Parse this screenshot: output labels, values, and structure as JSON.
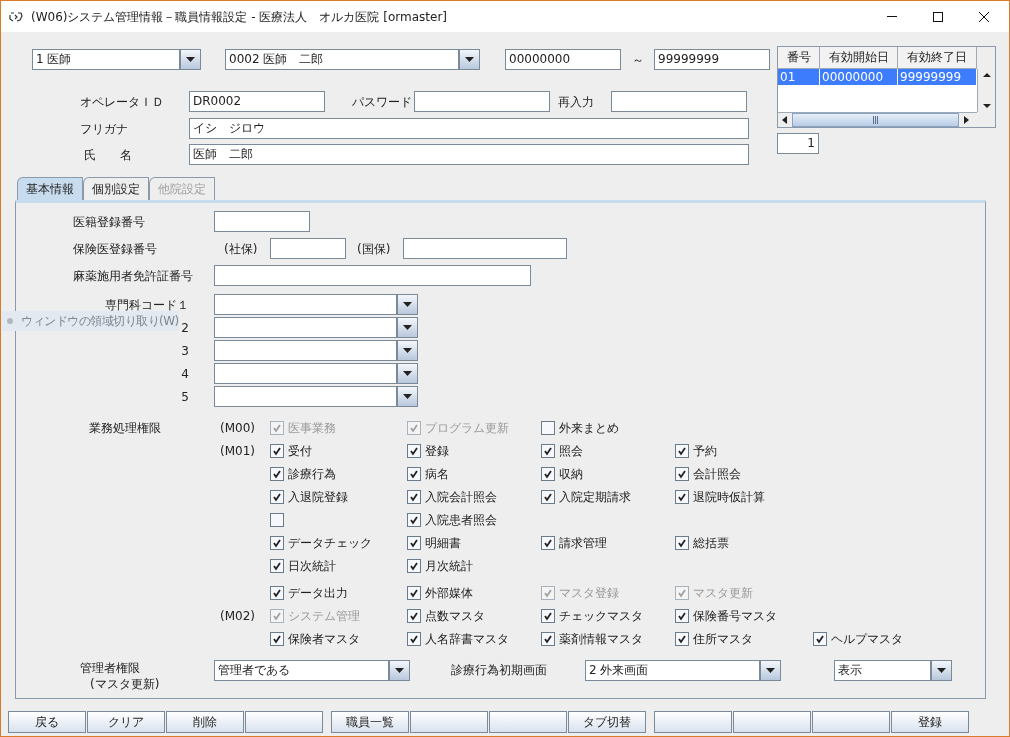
{
  "window": {
    "title": "(W06)システム管理情報－職員情報設定 - 医療法人　オルカ医院  [ormaster]"
  },
  "selectors": {
    "type": {
      "value": "1 医師"
    },
    "staff": {
      "value": "0002 医師　二郎"
    },
    "date_from": {
      "value": "00000000"
    },
    "range_mark": "～",
    "date_to": {
      "value": "99999999"
    }
  },
  "period_table": {
    "columns": [
      "番号",
      "有効開始日",
      "有効終了日"
    ],
    "rows": [
      {
        "cells": [
          "01",
          "00000000",
          "99999999"
        ],
        "selected": true
      }
    ],
    "count": "1"
  },
  "operator": {
    "id_label": "オペレータＩＤ",
    "id_value": "DR0002",
    "password_label": "パスワード",
    "reenter_label": "再入力",
    "kana_label": "フリガナ",
    "kana_value": "イシ　ジロウ",
    "name_label": "氏　　名",
    "name_value": "医師　二郎"
  },
  "tabs": [
    {
      "label": "基本情報",
      "selected": true,
      "disabled": false
    },
    {
      "label": "個別設定",
      "selected": false,
      "disabled": false
    },
    {
      "label": "他院設定",
      "selected": false,
      "disabled": true
    }
  ],
  "basic": {
    "registry_label": "医籍登録番号",
    "insurance_label": "保険医登録番号",
    "shaho_label": "(社保)",
    "kokuho_label": "(国保)",
    "narcotic_label": "麻薬施用者免許証番号",
    "specialty_codes": [
      {
        "label": "専門科コード１"
      },
      {
        "label": "2"
      },
      {
        "label": "3"
      },
      {
        "label": "4"
      },
      {
        "label": "5"
      }
    ],
    "permissions_label": "業務処理権限",
    "permission_rows": [
      {
        "group": "(M00)",
        "items": [
          {
            "label": "医事業務",
            "checked": true,
            "disabled": true
          },
          {
            "label": "プログラム更新",
            "checked": true,
            "disabled": true
          },
          {
            "label": "外来まとめ",
            "checked": false,
            "disabled": false
          }
        ]
      },
      {
        "group": "(M01)",
        "items": [
          {
            "label": "受付",
            "checked": true,
            "disabled": false
          },
          {
            "label": "登録",
            "checked": true,
            "disabled": false
          },
          {
            "label": "照会",
            "checked": true,
            "disabled": false
          },
          {
            "label": "予約",
            "checked": true,
            "disabled": false
          }
        ]
      },
      {
        "items": [
          {
            "label": "診療行為",
            "checked": true,
            "disabled": false
          },
          {
            "label": "病名",
            "checked": true,
            "disabled": false
          },
          {
            "label": "収納",
            "checked": true,
            "disabled": false
          },
          {
            "label": "会計照会",
            "checked": true,
            "disabled": false
          }
        ]
      },
      {
        "items": [
          {
            "label": "入退院登録",
            "checked": true,
            "disabled": false
          },
          {
            "label": "入院会計照会",
            "checked": true,
            "disabled": false
          },
          {
            "label": "入院定期請求",
            "checked": true,
            "disabled": false
          },
          {
            "label": "退院時仮計算",
            "checked": true,
            "disabled": false
          }
        ]
      },
      {
        "items": [
          {
            "checked": false,
            "disabled": false
          },
          {
            "label": "入院患者照会",
            "checked": true,
            "disabled": false
          }
        ]
      },
      {
        "items": [
          {
            "label": "データチェック",
            "checked": true,
            "disabled": false
          },
          {
            "label": "明細書",
            "checked": true,
            "disabled": false
          },
          {
            "label": "請求管理",
            "checked": true,
            "disabled": false
          },
          {
            "label": "総括票",
            "checked": true,
            "disabled": false
          }
        ]
      },
      {
        "items": [
          {
            "label": "日次統計",
            "checked": true,
            "disabled": false
          },
          {
            "label": "月次統計",
            "checked": true,
            "disabled": false
          }
        ]
      },
      {
        "items": [
          {
            "label": "データ出力",
            "checked": true,
            "disabled": false
          },
          {
            "label": "外部媒体",
            "checked": true,
            "disabled": false
          },
          {
            "label": "マスタ登録",
            "checked": true,
            "disabled": true
          },
          {
            "label": "マスタ更新",
            "checked": true,
            "disabled": true
          }
        ]
      },
      {
        "group": "(M02)",
        "items": [
          {
            "label": "システム管理",
            "checked": true,
            "disabled": true
          },
          {
            "label": "点数マスタ",
            "checked": true,
            "disabled": false
          },
          {
            "label": "チェックマスタ",
            "checked": true,
            "disabled": false
          },
          {
            "label": "保険番号マスタ",
            "checked": true,
            "disabled": false
          }
        ]
      },
      {
        "items": [
          {
            "label": "保険者マスタ",
            "checked": true,
            "disabled": false
          },
          {
            "label": "人名辞書マスタ",
            "checked": true,
            "disabled": false
          },
          {
            "label": "薬剤情報マスタ",
            "checked": true,
            "disabled": false
          },
          {
            "label": "住所マスタ",
            "checked": true,
            "disabled": false
          },
          {
            "label": "ヘルプマスタ",
            "checked": true,
            "disabled": false
          }
        ]
      }
    ],
    "admin_label": "管理者権限",
    "admin_sublabel": "(マスタ更新)",
    "admin_value": "管理者である",
    "initial_screen_label": "診療行為初期画面",
    "initial_screen_value": "2 外来画面",
    "display_value": "表示"
  },
  "function_keys": [
    [
      {
        "kind": "labeled",
        "label": "戻る"
      },
      {
        "kind": "labeled",
        "label": "クリア"
      },
      {
        "kind": "labeled",
        "label": "削除"
      },
      {
        "kind": "blank"
      }
    ],
    [
      {
        "kind": "labeled",
        "label": "職員一覧"
      },
      {
        "kind": "blank"
      },
      {
        "kind": "blank"
      },
      {
        "kind": "labeled",
        "label": "タブ切替"
      }
    ],
    [
      {
        "kind": "blank"
      },
      {
        "kind": "blank"
      },
      {
        "kind": "blank"
      },
      {
        "kind": "labeled",
        "label": "登録"
      }
    ]
  ],
  "overlay_hint": "ウィンドウの領域切り取り(W)"
}
